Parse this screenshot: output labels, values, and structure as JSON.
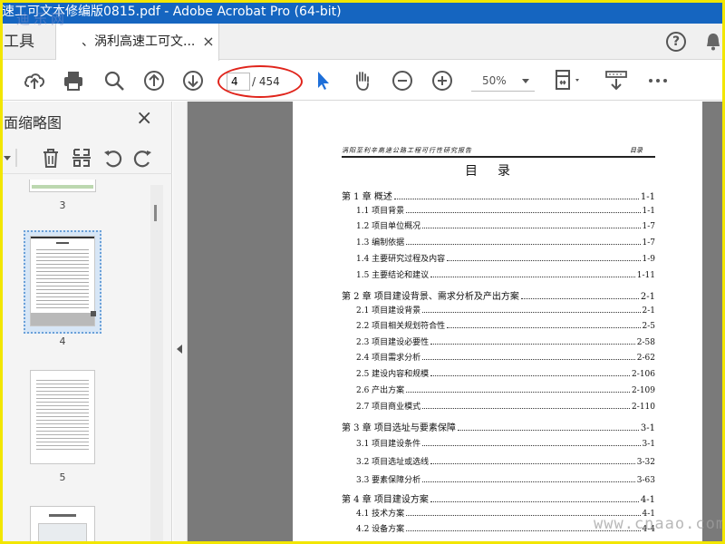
{
  "window": {
    "title": "速工可文本修编版0815.pdf - Adobe Acrobat Pro (64-bit)"
  },
  "watermarks": {
    "top": "迪乐网",
    "bottom": "www.cnaao.com"
  },
  "tabs": {
    "tools": "工具",
    "document": "、涡利高速工可文...",
    "close": "×"
  },
  "header_icons": {
    "help": "?"
  },
  "toolbar": {
    "page_current": "4",
    "page_total": "/ 454",
    "zoom": "50%"
  },
  "panel": {
    "title": "面缩略图",
    "close": "×",
    "thumbnails": [
      {
        "label": "3"
      },
      {
        "label": "4",
        "selected": true
      },
      {
        "label": "5"
      }
    ]
  },
  "document": {
    "header_left": "涡阳至利辛高速公路工程可行性研究报告",
    "header_right": "目录",
    "toc_title": "目录",
    "toc": [
      {
        "level": 1,
        "text": "第 1 章  概述",
        "page": "1-1"
      },
      {
        "level": 2,
        "text": "1.1  项目背景",
        "page": "1-1"
      },
      {
        "level": 2,
        "text": "1.2  项目单位概况",
        "page": "1-7"
      },
      {
        "level": 2,
        "text": "1.3  编制依据",
        "page": "1-7"
      },
      {
        "level": 2,
        "text": "1.4  主要研究过程及内容",
        "page": "1-9"
      },
      {
        "level": 2,
        "text": "1.5  主要结论和建议",
        "page": "1-11"
      },
      {
        "level": 1,
        "text": "第 2 章    项目建设背景、需求分析及产出方案",
        "page": "2-1"
      },
      {
        "level": 2,
        "text": "2.1 项目建设背景",
        "page": "2-1"
      },
      {
        "level": 2,
        "text": "2.2 项目相关规划符合性",
        "page": "2-5"
      },
      {
        "level": 2,
        "text": "2.3 项目建设必要性",
        "page": "2-58"
      },
      {
        "level": 2,
        "text": "2.4 项目需求分析",
        "page": "2-62"
      },
      {
        "level": 2,
        "text": "2.5 建设内容和规模",
        "page": "2-106"
      },
      {
        "level": 2,
        "text": "2.6 产出方案",
        "page": "2-109"
      },
      {
        "level": 2,
        "text": "2.7 项目商业模式",
        "page": "2-110"
      },
      {
        "level": 1,
        "text": "第 3 章  项目选址与要素保障",
        "page": "3-1"
      },
      {
        "level": 2,
        "text": "3.1 项目建设条件",
        "page": "3-1"
      },
      {
        "level": 2,
        "text": "3.2  项目选址或选线",
        "page": "3-32"
      },
      {
        "level": 2,
        "text": "3.3  要素保障分析",
        "page": "3-63"
      },
      {
        "level": 1,
        "text": "第 4 章  项目建设方案",
        "page": "4-1"
      },
      {
        "level": 2,
        "text": "4.1 技术方案",
        "page": "4-1"
      },
      {
        "level": 2,
        "text": "4.2 设备方案",
        "page": "4-4"
      }
    ]
  }
}
